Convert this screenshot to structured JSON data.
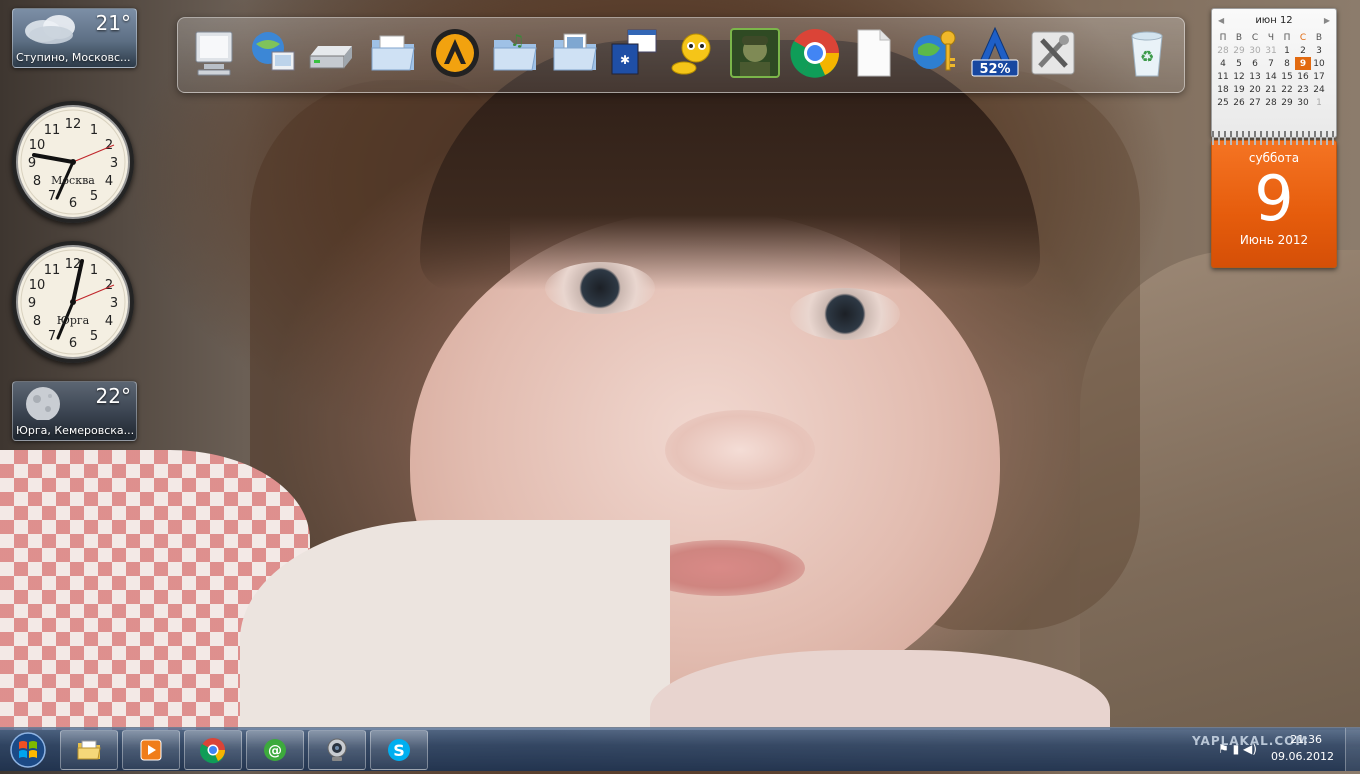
{
  "weather_gadgets": [
    {
      "temp": "21°",
      "place": "Ступино, Московс..."
    },
    {
      "temp": "22°",
      "place": "Юрга, Кемеровска..."
    }
  ],
  "clocks": [
    {
      "city": "Москва"
    },
    {
      "city": "Юрга"
    }
  ],
  "dock": {
    "items": [
      {
        "icon": "computer-icon"
      },
      {
        "icon": "network-globe-icon"
      },
      {
        "icon": "drive-icon"
      },
      {
        "icon": "documents-folder-icon"
      },
      {
        "icon": "aimp-player-icon"
      },
      {
        "icon": "music-folder-icon"
      },
      {
        "icon": "pictures-folder-icon"
      },
      {
        "icon": "window-switcher-icon"
      },
      {
        "icon": "qip-messenger-icon"
      },
      {
        "icon": "game-soldier-icon"
      },
      {
        "icon": "chrome-icon"
      },
      {
        "icon": "blank-document-icon"
      },
      {
        "icon": "globe-key-icon"
      },
      {
        "icon": "download-manager-icon",
        "badge": "52%"
      },
      {
        "icon": "tools-icon"
      },
      {
        "icon": "recycle-bin-icon"
      }
    ]
  },
  "calendar": {
    "month_label": "июн 12",
    "weekdays": [
      "П",
      "В",
      "С",
      "Ч",
      "П",
      "С",
      "В"
    ],
    "weeks": [
      [
        "28",
        "29",
        "30",
        "31",
        "1",
        "2",
        "3"
      ],
      [
        "4",
        "5",
        "6",
        "7",
        "8",
        "9",
        "10"
      ],
      [
        "11",
        "12",
        "13",
        "14",
        "15",
        "16",
        "17"
      ],
      [
        "18",
        "19",
        "20",
        "21",
        "22",
        "23",
        "24"
      ],
      [
        "25",
        "26",
        "27",
        "28",
        "29",
        "30",
        "1"
      ]
    ],
    "today": "9"
  },
  "day_card": {
    "weekday": "суббота",
    "day": "9",
    "month_year": "Июнь 2012"
  },
  "taskbar": {
    "pinned": [
      {
        "icon": "explorer-folder-icon"
      },
      {
        "icon": "media-player-icon"
      },
      {
        "icon": "chrome-icon"
      },
      {
        "icon": "mail-agent-icon"
      },
      {
        "icon": "webcam-icon"
      },
      {
        "icon": "skype-icon"
      }
    ],
    "tray": {
      "watermark": "YAPLAKAL.COM",
      "time": "21:36",
      "date": "09.06.2012"
    }
  },
  "colors": {
    "accent_orange": "#e55c0c",
    "taskbar": "#2d4669"
  }
}
